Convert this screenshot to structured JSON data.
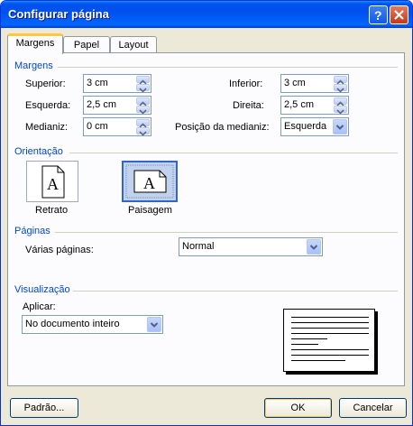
{
  "window": {
    "title": "Configurar página"
  },
  "tabs": [
    {
      "label": "Margens"
    },
    {
      "label": "Papel"
    },
    {
      "label": "Layout"
    }
  ],
  "margins": {
    "group_label": "Margens",
    "top": {
      "label": "Superior:",
      "value": "3 cm"
    },
    "left": {
      "label": "Esquerda:",
      "value": "2,5 cm"
    },
    "gutter": {
      "label": "Medianiz:",
      "value": "0 cm"
    },
    "bottom": {
      "label": "Inferior:",
      "value": "3 cm"
    },
    "right": {
      "label": "Direita:",
      "value": "2,5 cm"
    },
    "gutter_pos": {
      "label": "Posição da medianiz:",
      "value": "Esquerda"
    }
  },
  "orientation": {
    "group_label": "Orientação",
    "portrait": {
      "label": "Retrato",
      "glyph": "A"
    },
    "landscape": {
      "label": "Paisagem",
      "glyph": "A"
    }
  },
  "pages": {
    "group_label": "Páginas",
    "multiple_label": "Várias páginas:",
    "multiple_value": "Normal"
  },
  "preview": {
    "group_label": "Visualização",
    "apply_label": "Aplicar:",
    "apply_value": "No documento inteiro"
  },
  "buttons": {
    "default": "Padrão...",
    "ok": "OK",
    "cancel": "Cancelar"
  },
  "colors": {
    "group_label": "#0046d5",
    "title_bar": "#0053ee",
    "selected_orientation": "#c1d2ee"
  }
}
